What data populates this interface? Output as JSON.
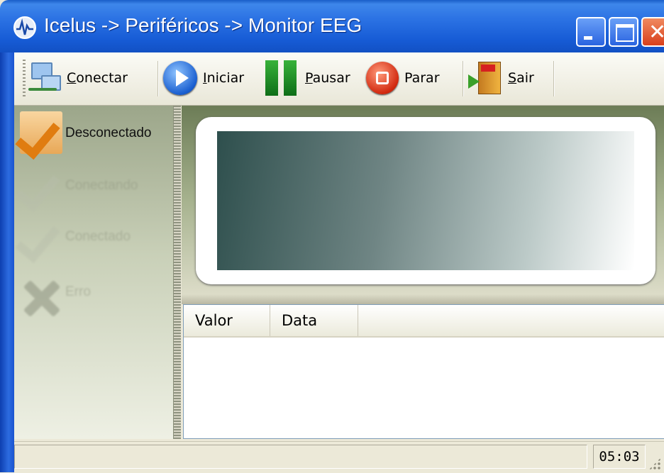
{
  "window": {
    "title": "Icelus -> Periféricos -> Monitor EEG",
    "title_icon": "eeg-wave-icon",
    "caption_buttons": [
      "minimize",
      "maximize",
      "close"
    ],
    "close_glyph": "✕"
  },
  "toolbar": {
    "buttons": [
      {
        "label": "Conectar",
        "icon": "network-computers-icon"
      },
      {
        "label": "Iniciar",
        "icon": "play-icon"
      },
      {
        "label": "Pausar",
        "icon": "pause-icon"
      },
      {
        "label": "Parar",
        "icon": "stop-icon"
      },
      {
        "label": "Sair",
        "icon": "exit-door-icon"
      }
    ]
  },
  "status_panel": {
    "items": [
      {
        "label": "Desconectado",
        "icon": "checkmark-icon",
        "active": true
      },
      {
        "label": "Conectando",
        "icon": "checkmark-icon",
        "active": false
      },
      {
        "label": "Conectado",
        "icon": "checkmark-icon",
        "active": false
      },
      {
        "label": "Erro",
        "icon": "x-mark-icon",
        "active": false
      }
    ]
  },
  "list": {
    "columns": [
      "Valor",
      "Data"
    ],
    "rows": []
  },
  "statusbar": {
    "message": "",
    "time": "05:03"
  },
  "colors": {
    "titlebar_blue": "#2c73e4",
    "active_check": "#e07c10"
  }
}
